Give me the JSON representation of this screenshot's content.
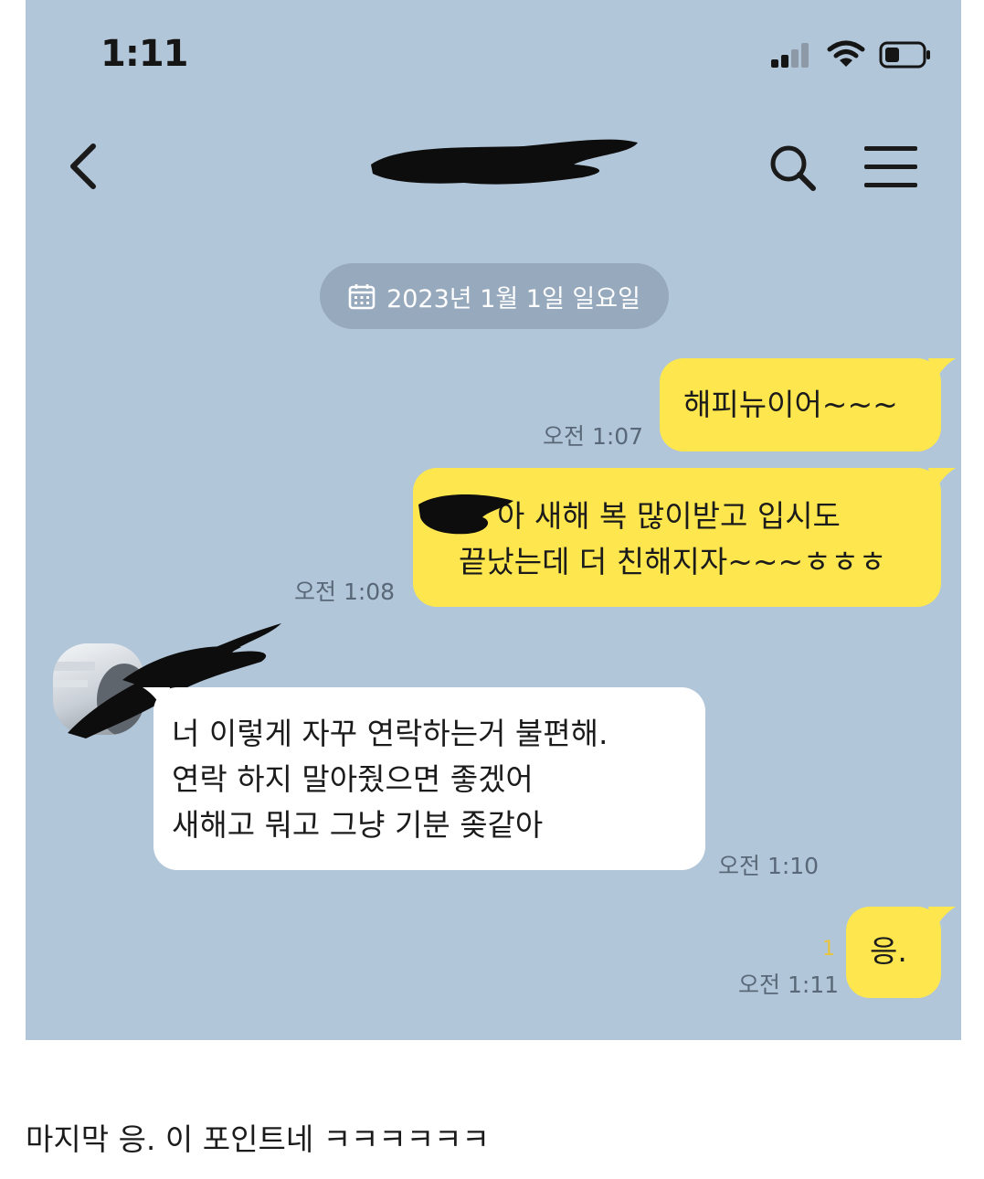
{
  "status_bar": {
    "time": "1:11"
  },
  "header": {
    "title": "",
    "back_icon": "chevron-left-icon",
    "search_icon": "search-icon",
    "menu_icon": "hamburger-menu-icon"
  },
  "date_divider": {
    "label": "2023년 1월 1일 일요일",
    "icon": "calendar-icon"
  },
  "messages": [
    {
      "sender": "me",
      "lines": [
        "해피뉴이어~~~"
      ],
      "time": "오전 1:07"
    },
    {
      "sender": "me",
      "lines": [
        "아 새해 복 많이받고 입시도",
        "끝났는데 더 친해지자~~~ㅎㅎㅎ"
      ],
      "time": "오전 1:08"
    },
    {
      "sender": "them",
      "lines": [
        "너 이렇게 자꾸 연락하는거 불편해.",
        "연락 하지 말아줬으면 좋겠어",
        "새해고 뭐고 그냥 기분 좆같아"
      ],
      "time": "오전 1:10"
    },
    {
      "sender": "me",
      "lines": [
        "응."
      ],
      "time": "오전 1:11",
      "unread": "1"
    }
  ],
  "caption": "마지막 응. 이 포인트네 ㅋㅋㅋㅋㅋㅋ",
  "colors": {
    "chat_background": "#b2c6d9",
    "my_bubble": "#fee64f",
    "their_bubble": "#ffffff",
    "date_chip": "#97aabd"
  }
}
